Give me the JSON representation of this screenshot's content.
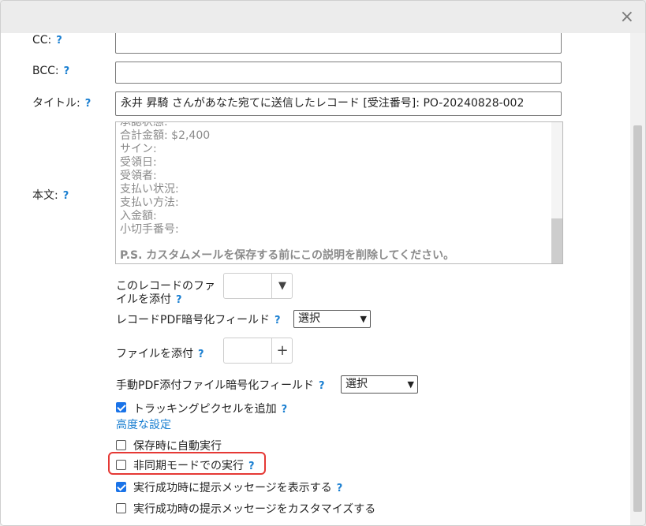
{
  "dialog": {
    "close_label": "×"
  },
  "cc": {
    "label": "CC:",
    "help": "?",
    "value": ""
  },
  "bcc": {
    "label": "BCC:",
    "help": "?",
    "value": ""
  },
  "title_field": {
    "label": "タイトル:",
    "help": "?",
    "value": "永井 昇騎 さんがあなた宛てに送信したレコード [受注番号]: PO-20240828-002"
  },
  "body": {
    "label": "本文:",
    "help": "?",
    "lines": [
      "承認状態:",
      "合計金額: $2,400",
      "サイン:",
      "受領日:",
      "受領者:",
      "支払い状況:",
      "支払い方法:",
      "入金額:",
      "小切手番号:"
    ],
    "ps": "P.S. カスタムメールを保存する前にこの説明を削除してください。"
  },
  "attach_record": {
    "label_line1": "このレコードのファ",
    "label_line2": "イルを添付",
    "help": "?",
    "button_icon": "▼"
  },
  "pdf_encrypt": {
    "label": "レコードPDF暗号化フィールド",
    "help": "?",
    "select_value": "選択"
  },
  "attach_file": {
    "label": "ファイルを添付",
    "help": "?",
    "button_icon": "+"
  },
  "manual_pdf_encrypt": {
    "label": "手動PDF添付ファイル暗号化フィールド",
    "help": "?",
    "select_value": "選択"
  },
  "tracking_pixel": {
    "label": "トラッキングピクセルを追加",
    "help": "?",
    "checked": true
  },
  "advanced_link": "高度な設定",
  "auto_run": {
    "label": "保存時に自動実行",
    "checked": false
  },
  "async_mode": {
    "label": "非同期モードでの実行",
    "help": "?",
    "checked": false
  },
  "show_message": {
    "label": "実行成功時に提示メッセージを表示する",
    "help": "?",
    "checked": true
  },
  "custom_message": {
    "label": "実行成功時の提示メッセージをカスタマイズする",
    "checked": false
  },
  "colors": {
    "accent": "#1a7fd1",
    "checkbox": "#1a73e8",
    "highlight": "#e53935"
  }
}
